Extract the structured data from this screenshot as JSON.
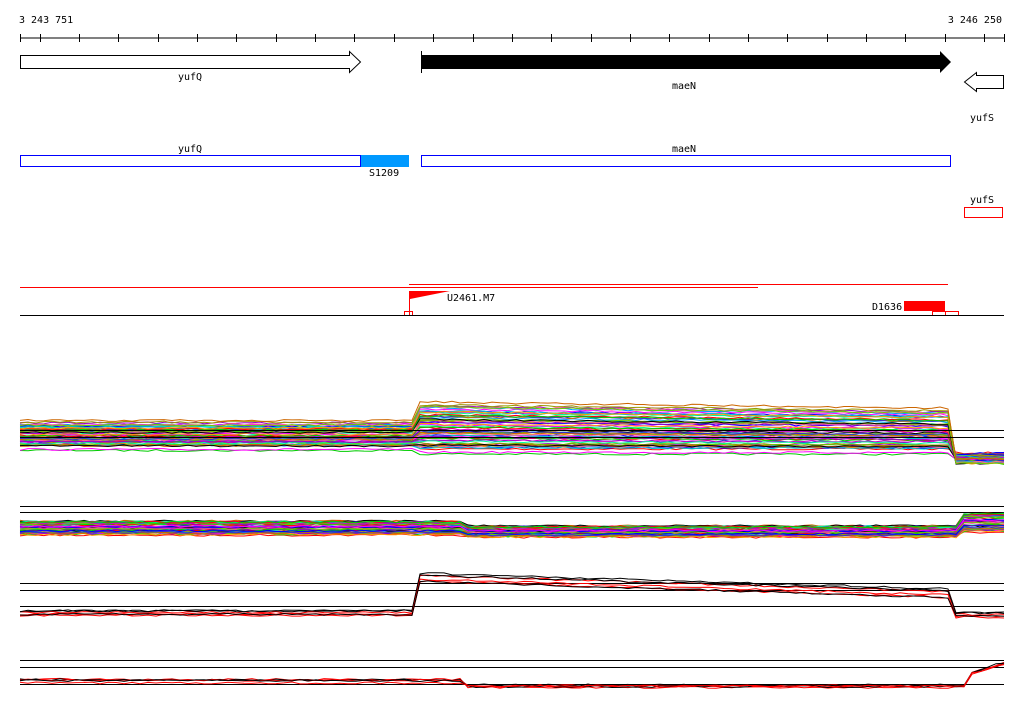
{
  "ruler": {
    "start": "3 243 751",
    "end": "3 246 250"
  },
  "genes_top": [
    {
      "name": "yufQ",
      "strand": "+",
      "style": "open"
    },
    {
      "name": "maeN",
      "strand": "+",
      "style": "filled"
    },
    {
      "name": "yufS",
      "strand": "-",
      "style": "open"
    }
  ],
  "annotations": {
    "yufQ": "yufQ",
    "maeN": "maeN",
    "yufS": "yufS",
    "segment": "S1209"
  },
  "features": {
    "upstream": "U2461.M7",
    "downstream": "D1636"
  },
  "colors": {
    "red": "#ff0000",
    "blue": "#0000ff",
    "cyan": "#0099ff"
  }
}
